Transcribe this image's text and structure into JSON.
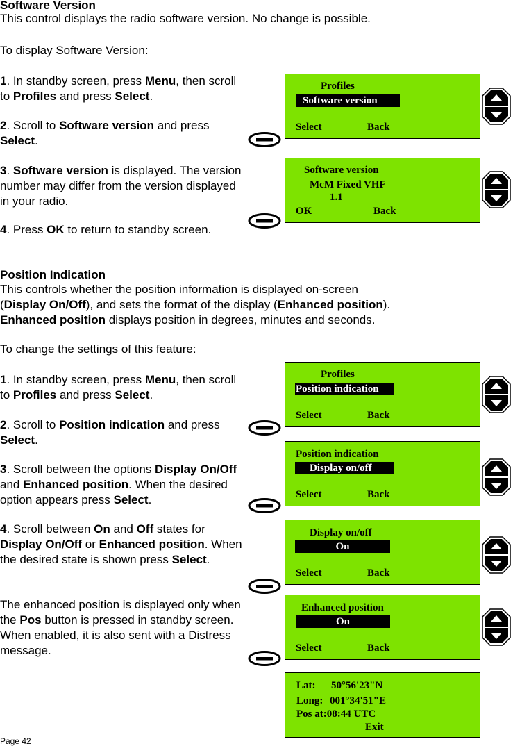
{
  "sections": {
    "software": {
      "heading": "Software Version",
      "intro": "This control displays the radio software version. No change is possible.",
      "lead": "To display Software Version:",
      "steps": [
        {
          "num": "1",
          "parts": [
            ". In standby screen, press ",
            "Menu",
            ", then scroll",
            "to ",
            "Profiles",
            " and press ",
            "Select",
            "."
          ]
        },
        {
          "num": "2",
          "parts": [
            ". Scroll to ",
            "Software version",
            " and press",
            "Select",
            "."
          ]
        },
        {
          "num": "3",
          "parts": [
            ". ",
            "Software version",
            " is displayed. The version",
            "number may differ from the version displayed",
            "in your radio."
          ]
        },
        {
          "num": "4",
          "parts": [
            ". Press ",
            "OK",
            " to return to standby screen."
          ]
        }
      ]
    },
    "position": {
      "heading": "Position Indication",
      "intro_l1": "This controls whether the position information is displayed on-screen",
      "intro_l2": [
        "(",
        "Display On/Off",
        "), and sets the format of the display (",
        "Enhanced position",
        ")."
      ],
      "intro_l3": [
        "Enhanced position",
        " displays position in degrees, minutes and seconds."
      ],
      "lead": "To change the settings of this feature:",
      "steps": [
        {
          "num": "1",
          "parts": [
            ". In standby screen, press ",
            "Menu",
            ", then scroll",
            "to ",
            "Profiles",
            " and press ",
            "Select",
            "."
          ]
        },
        {
          "num": "2",
          "parts": [
            ". Scroll to ",
            "Position indication",
            " and press",
            "Select",
            "."
          ]
        },
        {
          "num": "3",
          "parts": [
            ". Scroll between the options ",
            "Display On/Off",
            "and ",
            "Enhanced position",
            ". When the desired",
            "option appears press ",
            "Select",
            "."
          ]
        },
        {
          "num": "4",
          "parts": [
            ". Scroll between ",
            "On",
            " and ",
            "Off",
            " states for",
            "Display On/Off",
            " or ",
            "Enhanced position",
            ". When",
            "the desired state is shown press ",
            "Select",
            "."
          ]
        }
      ],
      "note_l1": "The enhanced position is displayed only when",
      "note_l2": [
        "the ",
        "Pos",
        " button is pressed in standby screen."
      ],
      "note_l3": "When enabled, it is also sent with a Distress",
      "note_l4": "message."
    }
  },
  "screens": [
    {
      "title": "Profiles",
      "highlight": "Software version",
      "left": "Select",
      "right": "Back"
    },
    {
      "l1": "Software version",
      "l2": "McM Fixed VHF",
      "l3": "1.1",
      "left": "OK",
      "right": "Back"
    },
    {
      "title": "Profiles",
      "highlight": "Position indication",
      "left": "Select",
      "right": "Back"
    },
    {
      "title": "Position indication",
      "highlight": "Display on/off",
      "left": "Select",
      "right": "Back"
    },
    {
      "title": "Display on/off",
      "highlight": "On",
      "left": "Select",
      "right": "Back"
    },
    {
      "title": "Enhanced position",
      "highlight": "On",
      "left": "Select",
      "right": "Back"
    },
    {
      "lat_label": "Lat:",
      "lat": "50°56'23\"N",
      "long_label": "Long:",
      "long": "001°34'51\"E",
      "pos_at": "Pos at:08:44 UTC",
      "exit": "Exit"
    }
  ],
  "colors": {
    "lcd_background": "#7ee300"
  },
  "footer": {
    "page": "Page 42"
  }
}
